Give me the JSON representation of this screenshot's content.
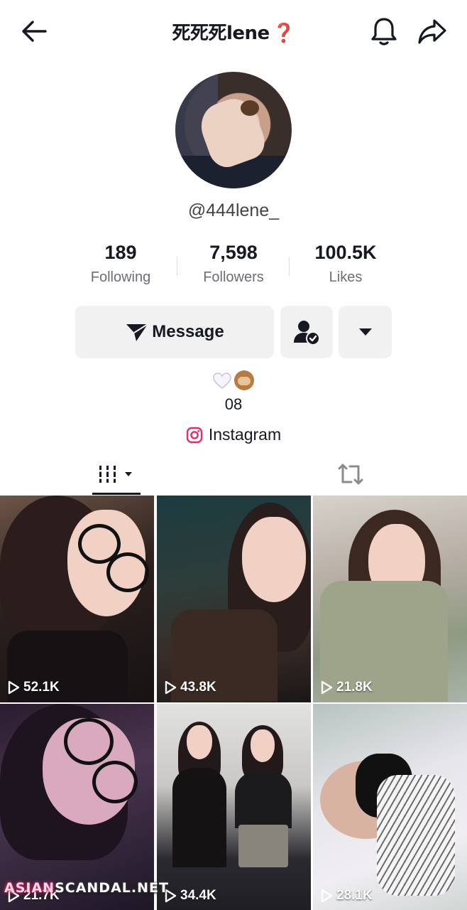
{
  "header": {
    "title": "死死死lene",
    "title_suffix": "❓",
    "back_icon": "arrow-left-icon",
    "bell_icon": "bell-icon",
    "share_icon": "share-arrow-icon"
  },
  "profile": {
    "handle": "@444lene_",
    "stats": [
      {
        "value": "189",
        "label": "Following"
      },
      {
        "value": "7,598",
        "label": "Followers"
      },
      {
        "value": "100.5K",
        "label": "Likes"
      }
    ],
    "message_label": "Message",
    "bio_line": "08",
    "bio_emojis": "🤍🙈",
    "link_label": "Instagram"
  },
  "tabs": {
    "active": "videos",
    "items": [
      "videos-grid-icon",
      "repost-icon"
    ]
  },
  "videos": [
    {
      "views": "52.1K"
    },
    {
      "views": "43.8K"
    },
    {
      "views": "21.8K"
    },
    {
      "views": "21.7K"
    },
    {
      "views": "34.4K"
    },
    {
      "views": "28.1K"
    }
  ],
  "watermark": {
    "part1": "ASIAN",
    "part2": "SCANDAL.NET"
  },
  "colors": {
    "accent": "#fe2c55",
    "text": "#161823",
    "secondary": "#6b6d77",
    "button_bg": "#f1f1f2"
  }
}
